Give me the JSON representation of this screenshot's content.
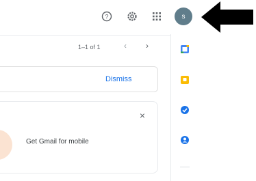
{
  "header": {
    "help_icon": "help-circle-icon",
    "settings_icon": "gear-icon",
    "apps_icon": "apps-grid-icon",
    "avatar_initial": "s",
    "annotation": "black-arrow-pointing-left"
  },
  "toolbar": {
    "pagination": "1–1 of 1",
    "prev_icon": "‹",
    "next_icon": "›"
  },
  "banner": {
    "dismiss_label": "Dismiss"
  },
  "promo_card": {
    "text": "Get Gmail for mobile",
    "close_icon": "×"
  },
  "side_panel": {
    "items": [
      "calendar-icon",
      "keep-icon",
      "tasks-icon",
      "contacts-icon"
    ]
  },
  "colors": {
    "accent": "#1a73e8",
    "avatar_bg": "#607d8b",
    "calendar": "#4285f4",
    "keep": "#fbbc04",
    "tasks": "#1a73e8",
    "contacts": "#1a73e8"
  }
}
